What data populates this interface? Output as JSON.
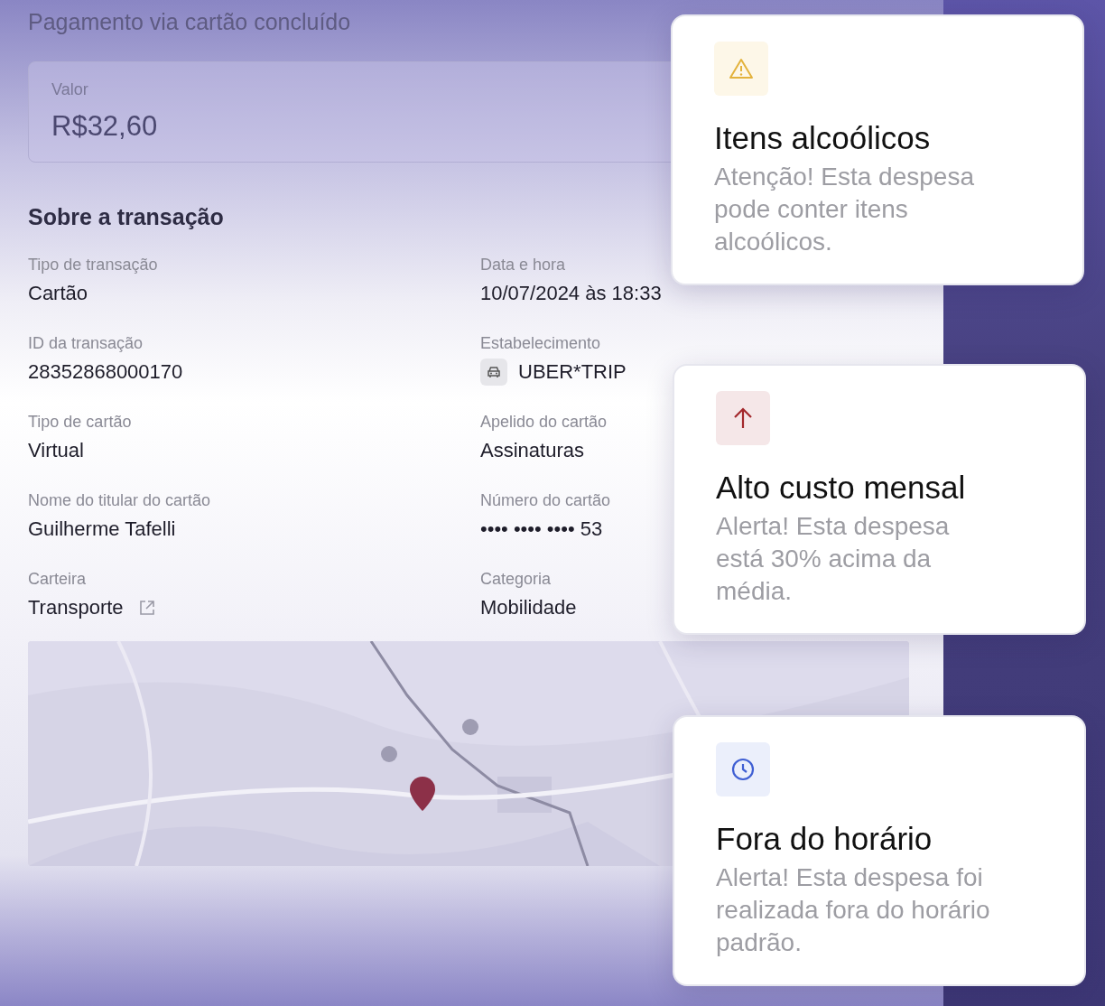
{
  "header": {
    "title": "Pagamento via cartão concluído"
  },
  "amount": {
    "label": "Valor",
    "value": "R$32,60"
  },
  "section": {
    "title": "Sobre a transação"
  },
  "fields": [
    {
      "label": "Tipo de transação",
      "value": "Cartão",
      "kind": "plain"
    },
    {
      "label": "Data e hora",
      "value": "10/07/2024 às 18:33",
      "kind": "plain"
    },
    {
      "label": "ID da transação",
      "value": "28352868000170",
      "kind": "plain"
    },
    {
      "label": "Estabelecimento",
      "value": "UBER*TRIP",
      "kind": "merchant"
    },
    {
      "label": "Tipo de cartão",
      "value": "Virtual",
      "kind": "plain"
    },
    {
      "label": "Apelido do cartão",
      "value": "Assinaturas",
      "kind": "plain"
    },
    {
      "label": "Nome do titular do cartão",
      "value": "Guilherme Tafelli",
      "kind": "plain"
    },
    {
      "label": "Número do cartão",
      "value": "•••• •••• •••• 53",
      "kind": "plain"
    },
    {
      "label": "Carteira",
      "value": "Transporte",
      "kind": "link"
    },
    {
      "label": "Categoria",
      "value": "Mobilidade",
      "kind": "plain"
    }
  ],
  "alerts": [
    {
      "kind": "warning",
      "title": "Itens alcoólicos",
      "text": "Atenção! Esta despesa pode conter itens alcoólicos."
    },
    {
      "kind": "increase",
      "title": "Alto custo mensal",
      "text": "Alerta! Esta despesa está 30% acima da média."
    },
    {
      "kind": "time",
      "title": "Fora do horário",
      "text": "Alerta! Esta despesa foi realizada fora do horário padrão."
    }
  ]
}
